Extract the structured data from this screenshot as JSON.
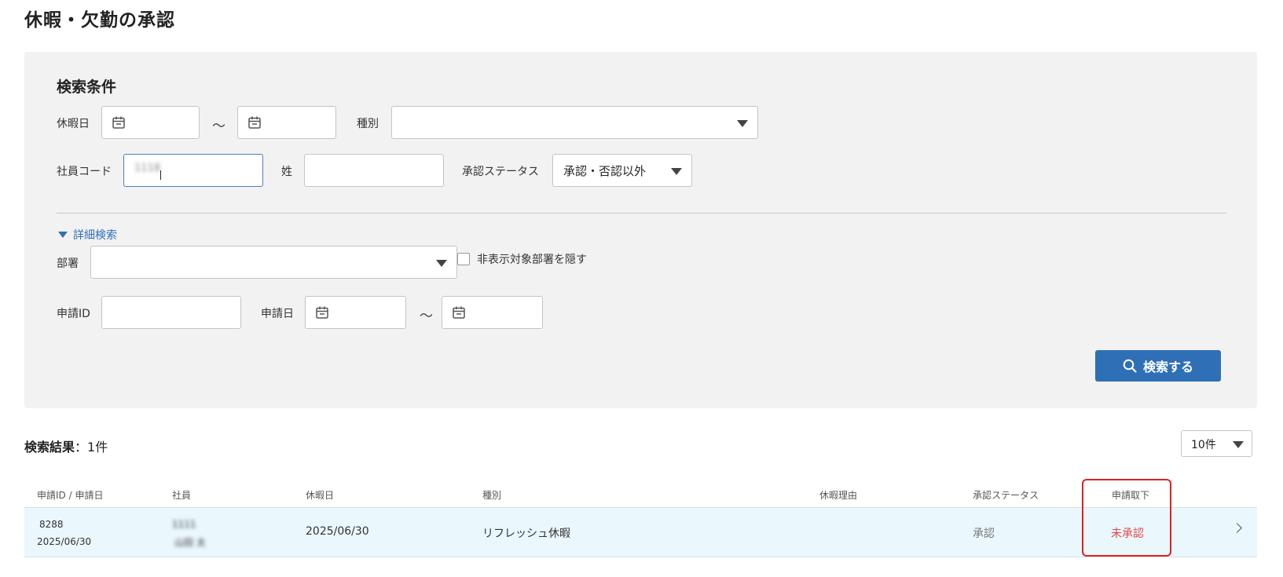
{
  "page": {
    "title": "休暇・欠勤の承認"
  },
  "search": {
    "heading": "検索条件",
    "leave_date_label": "休暇日",
    "range_separator": "～",
    "type_label": "種別",
    "type_value": "",
    "employee_code_label": "社員コード",
    "employee_code_value": "1118",
    "last_name_label": "姓",
    "last_name_value": "",
    "approval_status_label": "承認ステータス",
    "approval_status_value": "承認・否認以外",
    "detail_toggle_label": "詳細検索",
    "department_label": "部署",
    "department_value": "",
    "hide_department_label": "非表示対象部署を隠す",
    "application_id_label": "申請ID",
    "application_date_label": "申請日",
    "search_button_label": "検索する"
  },
  "results": {
    "label": "検索結果",
    "count_text": "：1件",
    "per_page_value": "10件",
    "columns": [
      "申請ID / 申請日",
      "社員",
      "休暇日",
      "種別",
      "休暇理由",
      "承認ステータス",
      "申請取下"
    ],
    "rows": [
      {
        "application_id": "8288",
        "application_date": "2025/06/30",
        "employee_code": "1111",
        "employee_name": "山田 太",
        "leave_date": "2025/06/30",
        "type": "リフレッシュ休暇",
        "reason": "",
        "approval_status": "承認",
        "withdrawal": "未承認"
      }
    ]
  },
  "colors": {
    "accent": "#2f6fb5",
    "panel_bg": "#f2f2f2",
    "row_bg": "#eaf7fc",
    "pending_red": "#e04848",
    "highlight_red": "#e02020"
  },
  "icons": [
    "calendar-icon",
    "select-arrow-icon",
    "search-icon",
    "chevron-right-icon",
    "triangle-down-icon"
  ]
}
